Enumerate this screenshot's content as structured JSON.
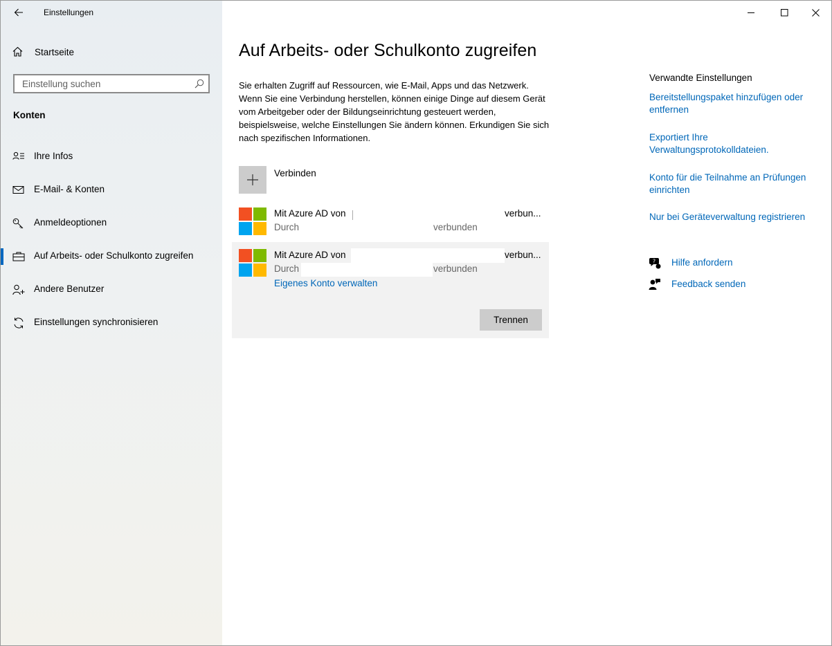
{
  "window": {
    "app_title": "Einstellungen"
  },
  "sidebar": {
    "home_label": "Startseite",
    "search_placeholder": "Einstellung suchen",
    "section_title": "Konten",
    "items": [
      {
        "label": "Ihre Infos",
        "icon": "person-card-icon"
      },
      {
        "label": "E-Mail- & Konten",
        "icon": "mail-icon"
      },
      {
        "label": "Anmeldeoptionen",
        "icon": "key-icon"
      },
      {
        "label": "Auf Arbeits- oder Schulkonto zugreifen",
        "icon": "briefcase-icon",
        "active": true
      },
      {
        "label": "Andere Benutzer",
        "icon": "person-add-icon"
      },
      {
        "label": "Einstellungen synchronisieren",
        "icon": "sync-icon"
      }
    ]
  },
  "main": {
    "title": "Auf Arbeits- oder Schulkonto zugreifen",
    "description": "Sie erhalten Zugriff auf Ressourcen, wie E-Mail, Apps und das Netzwerk. Wenn Sie eine Verbindung herstellen, können einige Dinge auf diesem Gerät vom Arbeitgeber oder der Bildungseinrichtung gesteuert werden, beispielsweise, welche Einstellungen Sie ändern können. Erkundigen Sie sich nach spezifischen Informationen.",
    "connect_label": "Verbinden",
    "accounts": [
      {
        "title_prefix": "Mit Azure AD von",
        "title_suffix": "verbun...",
        "subtitle_prefix": "Durch",
        "subtitle_suffix": "verbunden"
      },
      {
        "title_prefix": "Mit Azure AD von",
        "title_suffix": "verbun...",
        "subtitle_prefix": "Durch",
        "subtitle_suffix": "verbunden",
        "manage_link": "Eigenes Konto verwalten",
        "disconnect_label": "Trennen"
      }
    ]
  },
  "related": {
    "title": "Verwandte Einstellungen",
    "links": [
      "Bereitstellungspaket hinzufügen oder entfernen",
      "Exportiert Ihre Verwaltungsprotokolldateien.",
      "Konto für die Teilnahme an Prüfungen einrichten",
      "Nur bei Geräteverwaltung registrieren"
    ],
    "help_label": "Hilfe anfordern",
    "feedback_label": "Feedback senden"
  },
  "colors": {
    "accent": "#0067b8",
    "ms_red": "#f25022",
    "ms_green": "#7fba00",
    "ms_blue": "#00a4ef",
    "ms_yellow": "#ffb900"
  }
}
